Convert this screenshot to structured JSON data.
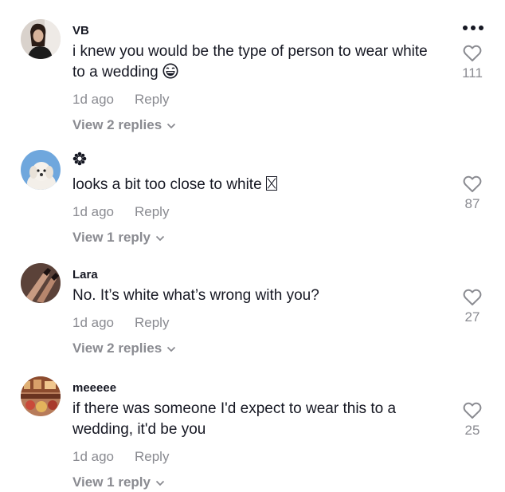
{
  "comments": [
    {
      "username": "VB",
      "text": "i knew you would be the type of person to wear white to a wedding",
      "emoji": "laughing-face-emoji",
      "time": "1d ago",
      "reply_label": "Reply",
      "view_replies": "View 2 replies",
      "likes": "111"
    },
    {
      "username": "",
      "username_icon": "flower-icon",
      "text": "looks a bit too close to white",
      "emoji": "missing-glyph-box",
      "time": "1d ago",
      "reply_label": "Reply",
      "view_replies": "View 1 reply",
      "likes": "87"
    },
    {
      "username": "Lara",
      "text": "No. It’s white what’s wrong with you?",
      "time": "1d ago",
      "reply_label": "Reply",
      "view_replies": "View 2 replies",
      "likes": "27"
    },
    {
      "username": "meeeee",
      "text": "if there was someone I'd expect to wear this to a wedding, it'd be you",
      "time": "1d ago",
      "reply_label": "Reply",
      "view_replies": "View 1 reply",
      "likes": "25"
    }
  ],
  "colors": {
    "text": "#161823",
    "secondary": "#8a8b91"
  }
}
